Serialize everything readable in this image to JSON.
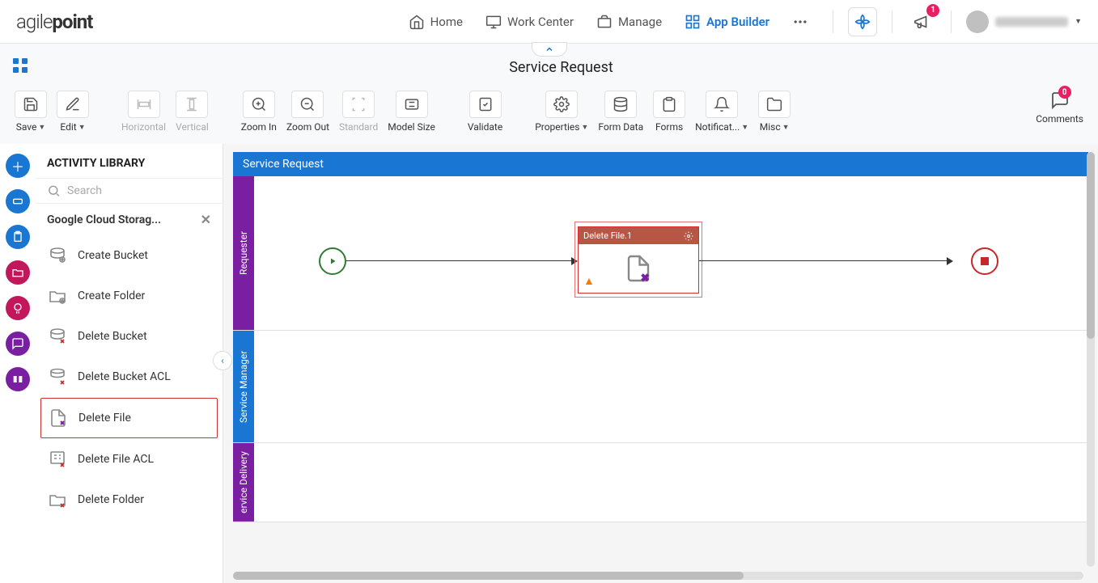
{
  "brand": {
    "prefix": "agile",
    "suffix": "point"
  },
  "nav": {
    "home": "Home",
    "work_center": "Work Center",
    "manage": "Manage",
    "app_builder": "App Builder",
    "notif_count": "1"
  },
  "page": {
    "title": "Service Request"
  },
  "toolbar": {
    "save": "Save",
    "edit": "Edit",
    "horizontal": "Horizontal",
    "vertical": "Vertical",
    "zoom_in": "Zoom In",
    "zoom_out": "Zoom Out",
    "standard": "Standard",
    "model_size": "Model Size",
    "validate": "Validate",
    "properties": "Properties",
    "form_data": "Form Data",
    "forms": "Forms",
    "notifications": "Notificat...",
    "misc": "Misc",
    "comments": "Comments",
    "comments_count": "0"
  },
  "sidebar": {
    "title": "ACTIVITY LIBRARY",
    "search_placeholder": "Search",
    "category": "Google Cloud Storag...",
    "items": [
      {
        "label": "Create Bucket"
      },
      {
        "label": "Create Folder"
      },
      {
        "label": "Delete Bucket"
      },
      {
        "label": "Delete Bucket ACL"
      },
      {
        "label": "Delete File"
      },
      {
        "label": "Delete File ACL"
      },
      {
        "label": "Delete Folder"
      }
    ]
  },
  "process": {
    "header": "Service Request",
    "lanes": {
      "requester": "Requester",
      "service_manager": "Service Manager",
      "service_delivery": "ervice Delivery"
    },
    "node": {
      "title": "Delete File.1"
    }
  }
}
